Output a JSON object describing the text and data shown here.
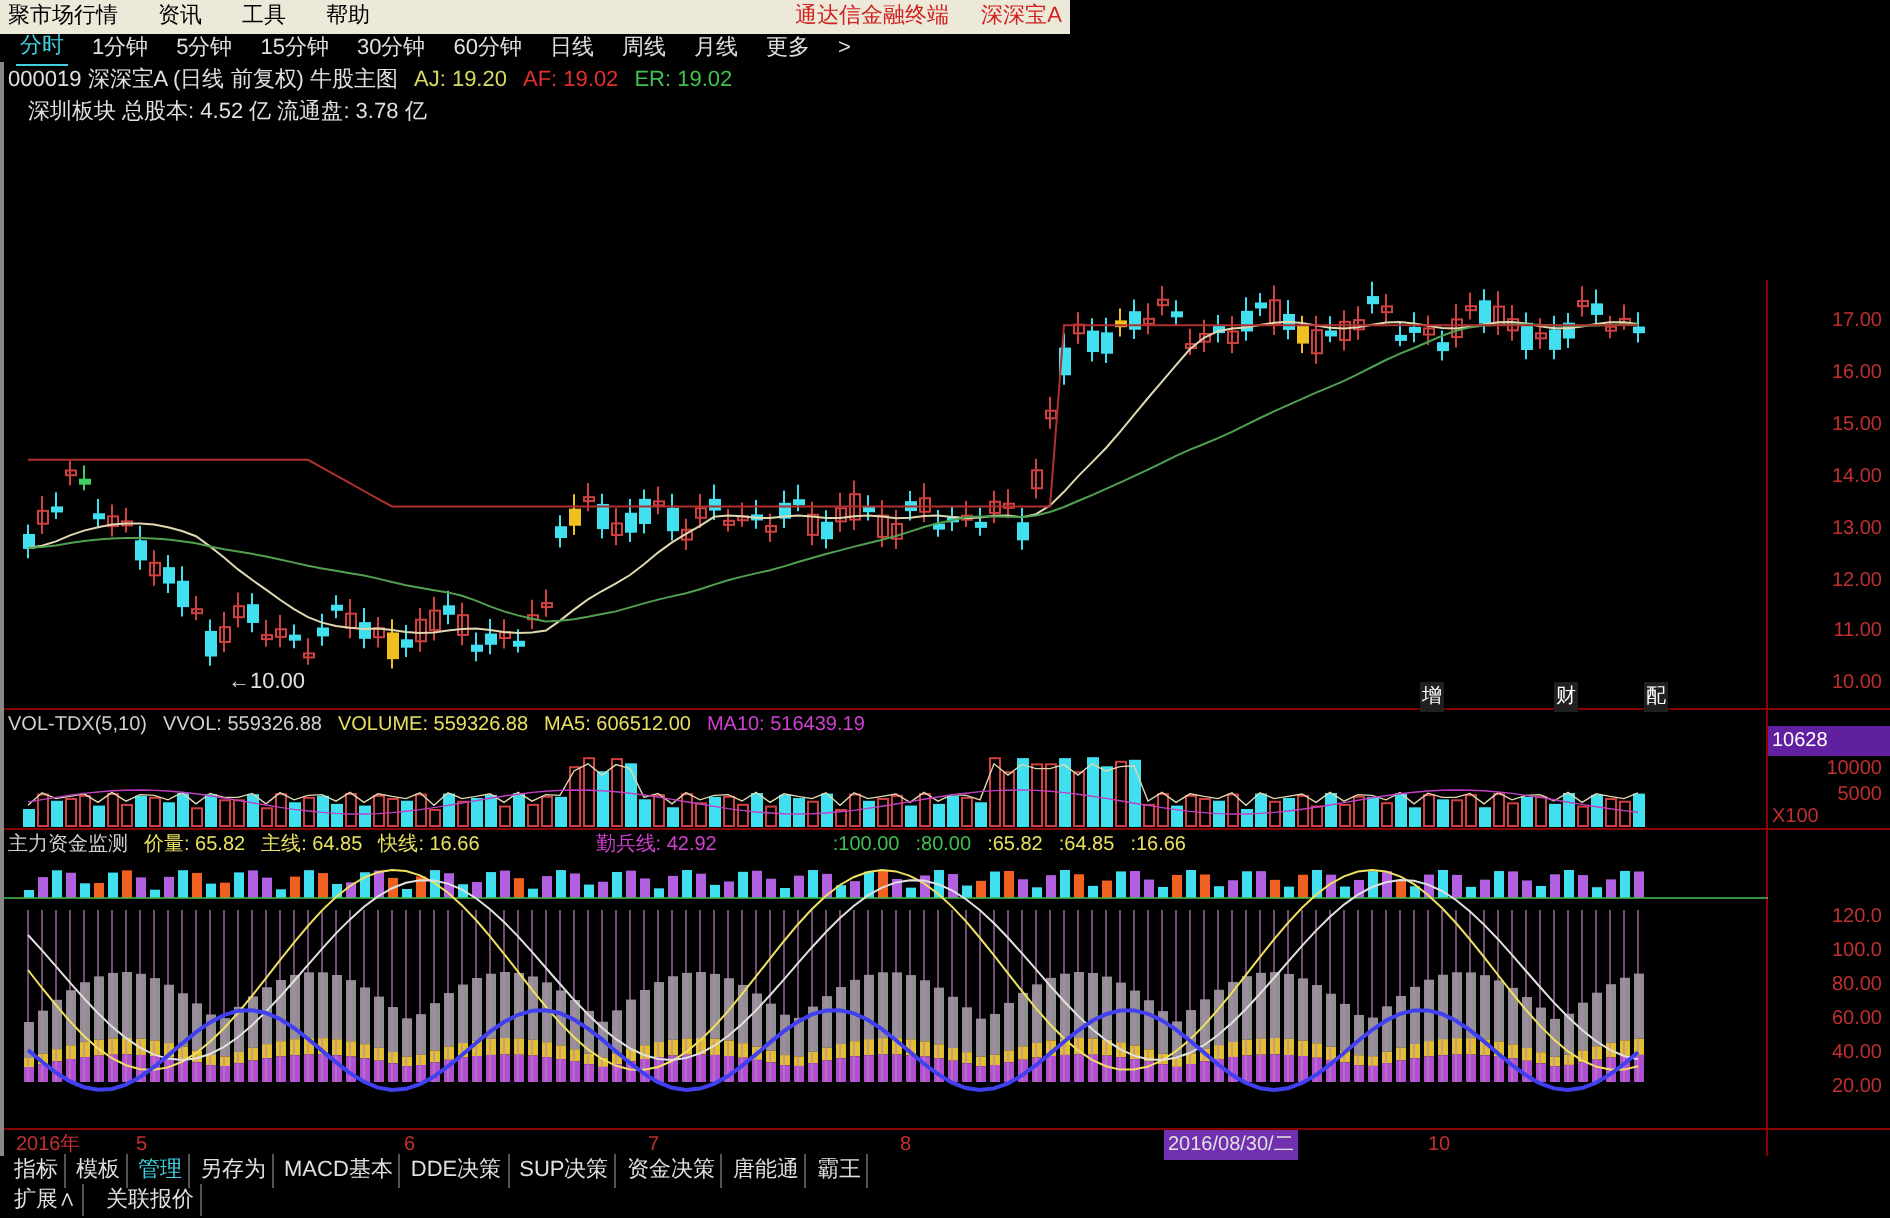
{
  "menu": {
    "items": [
      "聚市场行情",
      "资讯",
      "工具",
      "帮助"
    ],
    "right": [
      "通达信金融终端",
      "深深宝A"
    ]
  },
  "periods": [
    {
      "label": "分时",
      "selected": true
    },
    {
      "label": "1分钟",
      "selected": false
    },
    {
      "label": "5分钟",
      "selected": false
    },
    {
      "label": "15分钟",
      "selected": false
    },
    {
      "label": "30分钟",
      "selected": false
    },
    {
      "label": "60分钟",
      "selected": false
    },
    {
      "label": "日线",
      "selected": false
    },
    {
      "label": "周线",
      "selected": false
    },
    {
      "label": "月线",
      "selected": false
    },
    {
      "label": "更多",
      "selected": false
    },
    {
      "label": ">",
      "selected": false
    }
  ],
  "stock_info": {
    "title": "000019 深深宝A (日线 前复权) 牛股主图",
    "readings": [
      {
        "text": "AJ: 19.20",
        "color": "#d8d860"
      },
      {
        "text": "AF: 19.02",
        "color": "#e03030"
      },
      {
        "text": "ER: 19.02",
        "color": "#40c050"
      }
    ]
  },
  "board_info": "深圳板块 总股本: 4.52 亿 流通盘: 3.78 亿",
  "main_chart": {
    "y_ticks": [
      "17.00",
      "16.00",
      "15.00",
      "14.00",
      "13.00",
      "12.00",
      "11.00",
      "10.00"
    ],
    "low_label": "←10.00",
    "event_marks": [
      "增",
      "财",
      "配"
    ]
  },
  "volume_panel": {
    "legend": [
      {
        "text": "VOL-TDX(5,10)",
        "color": "#d0d0d0"
      },
      {
        "text": "VVOL: 559326.88",
        "color": "#d0d0d0"
      },
      {
        "text": "VOLUME: 559326.88",
        "color": "#e8e060"
      },
      {
        "text": "MA5: 606512.00",
        "color": "#e8e060"
      },
      {
        "text": "MA10: 516439.19",
        "color": "#d040d0"
      }
    ],
    "current_badge": "10628",
    "y_ticks": [
      "10000",
      "5000"
    ],
    "unit": "X100"
  },
  "indicator_panel": {
    "legend": [
      {
        "text": "主力资金监测",
        "color": "#d0d0d0"
      },
      {
        "text": "价量: 65.82",
        "color": "#e8e060"
      },
      {
        "text": "主线: 64.85",
        "color": "#e8e060"
      },
      {
        "text": "快线: 16.66",
        "color": "#e8e060"
      },
      {
        "text": "勤兵线: 42.92",
        "color": "#d040d0"
      },
      {
        "text": ":100.00",
        "color": "#40c050"
      },
      {
        "text": ":80.00",
        "color": "#40c050"
      },
      {
        "text": ":65.82",
        "color": "#e8e060"
      },
      {
        "text": ":64.85",
        "color": "#e8e060"
      },
      {
        "text": ":16.66",
        "color": "#e8e060"
      }
    ],
    "y_ticks": [
      "120.0",
      "100.0",
      "80.00",
      "60.00",
      "40.00",
      "20.00"
    ]
  },
  "date_axis": {
    "labels": [
      "2016年",
      "5",
      "6",
      "7",
      "8",
      "2016/08/30/二",
      "10"
    ]
  },
  "tabs": [
    {
      "label": "指标",
      "selected": false
    },
    {
      "label": "模板",
      "selected": false
    },
    {
      "label": "管理",
      "selected": true
    },
    {
      "label": "另存为",
      "selected": false
    },
    {
      "label": "MACD基本",
      "selected": false
    },
    {
      "label": "DDE决策",
      "selected": false
    },
    {
      "label": "SUP决策",
      "selected": false
    },
    {
      "label": "资金决策",
      "selected": false
    },
    {
      "label": "唐能通",
      "selected": false
    },
    {
      "label": "霸王",
      "selected": false
    }
  ],
  "bottom_links": [
    "扩展∧",
    "关联报价"
  ]
}
